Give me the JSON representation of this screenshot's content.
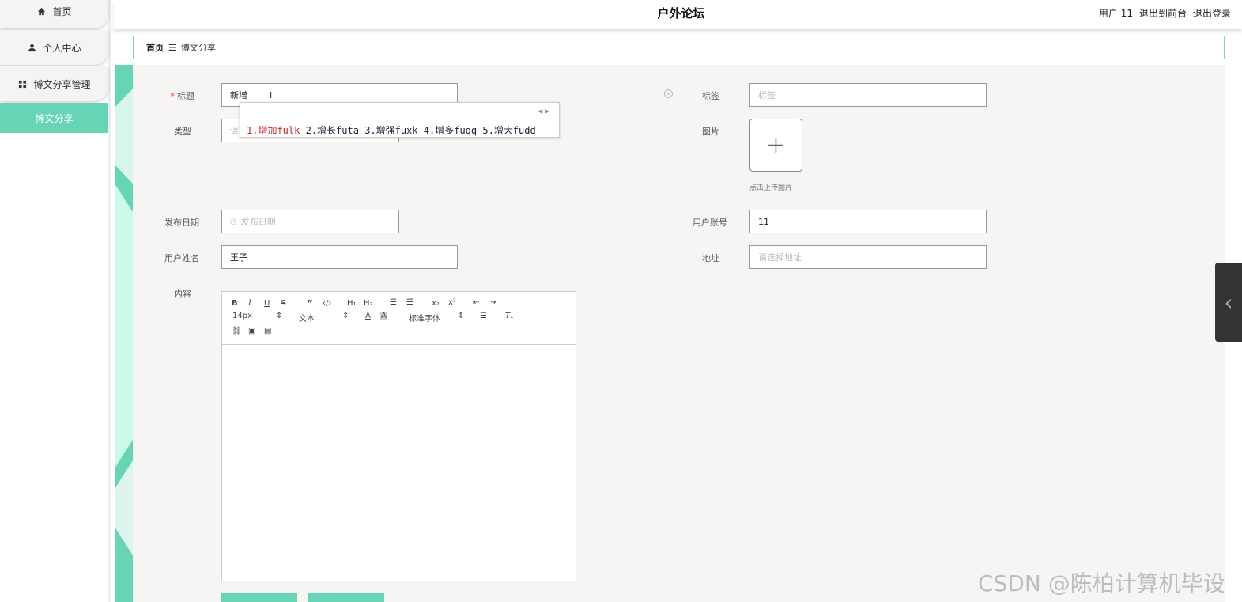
{
  "sidebar": {
    "items": [
      {
        "label": "首页",
        "icon": "home-icon"
      },
      {
        "label": "个人中心",
        "icon": "user-icon"
      },
      {
        "label": "博文分享管理",
        "icon": "grid-icon"
      },
      {
        "label": "博文分享",
        "active": true
      }
    ]
  },
  "header": {
    "title": "户外论坛",
    "user": "用户 11",
    "back_to_front": "退出到前台",
    "logout": "退出登录"
  },
  "breadcrumb": {
    "home": "首页",
    "sep": "☰",
    "current": "博文分享"
  },
  "form": {
    "title_label": "标题",
    "title_value": "新增",
    "type_label": "类型",
    "type_placeholder": "请",
    "tags_label": "标签",
    "tags_placeholder": "标签",
    "image_label": "图片",
    "upload_hint": "点击上传图片",
    "date_label": "发布日期",
    "date_placeholder": "发布日期",
    "account_label": "用户账号",
    "account_value": "11",
    "name_label": "用户姓名",
    "name_value": "王子",
    "address_label": "地址",
    "address_placeholder": "请选择地址",
    "content_label": "内容"
  },
  "editor": {
    "font_size": "14px",
    "paragraph": "文本",
    "font_family": "标准字体"
  },
  "ime": {
    "candidates": [
      "1.增加fulk",
      "2.增长futa",
      "3.增强fuxk",
      "4.增多fuqq",
      "5.增大fudd"
    ]
  },
  "watermark": "CSDN @陈柏计算机毕设",
  "colors": {
    "accent": "#67d5b5"
  }
}
